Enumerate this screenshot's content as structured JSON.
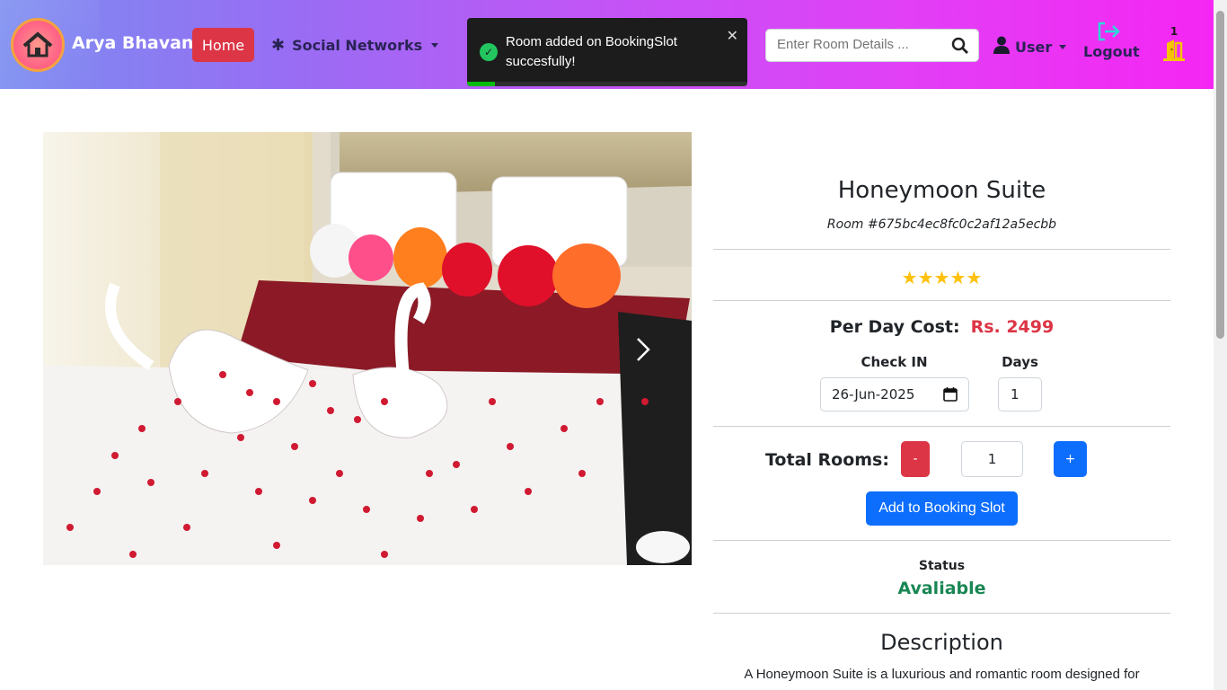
{
  "brand": {
    "name": "Arya Bhavan"
  },
  "nav": {
    "home_label": "Home",
    "social_label": "Social Networks",
    "search_placeholder": "Enter Room Details ...",
    "user_label": "User",
    "logout_label": "Logout",
    "cart_count": "1"
  },
  "toast": {
    "message": "Room added on BookingSlot succesfully!",
    "close": "✕",
    "progress_fraction": 0.1
  },
  "room": {
    "title": "Honeymoon Suite",
    "id_text": "Room #675bc4ec8fc0c2af12a5ecbb",
    "stars": "★★★★★",
    "cost_label": "Per Day Cost:",
    "cost_value": "Rs. 2499",
    "checkin_label": "Check IN",
    "checkin_value": "26-Jun-2025",
    "days_label": "Days",
    "days_value": "1",
    "total_rooms_label": "Total Rooms:",
    "minus_label": "-",
    "plus_label": "+",
    "rooms_value": "1",
    "add_button_label": "Add to Booking Slot",
    "status_label": "Status",
    "status_value": "Avaliable",
    "description_title": "Description",
    "description_text": "A Honeymoon Suite is a luxurious and romantic room designed for"
  },
  "colors": {
    "accent_red": "#dc3545",
    "accent_blue": "#0d6efd",
    "status_green": "#198754",
    "star_yellow": "#ffc107"
  },
  "icons": [
    "home-logo-icon",
    "slack-icon",
    "search-icon",
    "user-icon",
    "logout-icon",
    "door-icon",
    "check-circle-icon",
    "close-icon",
    "chevron-right-icon",
    "calendar-icon"
  ]
}
